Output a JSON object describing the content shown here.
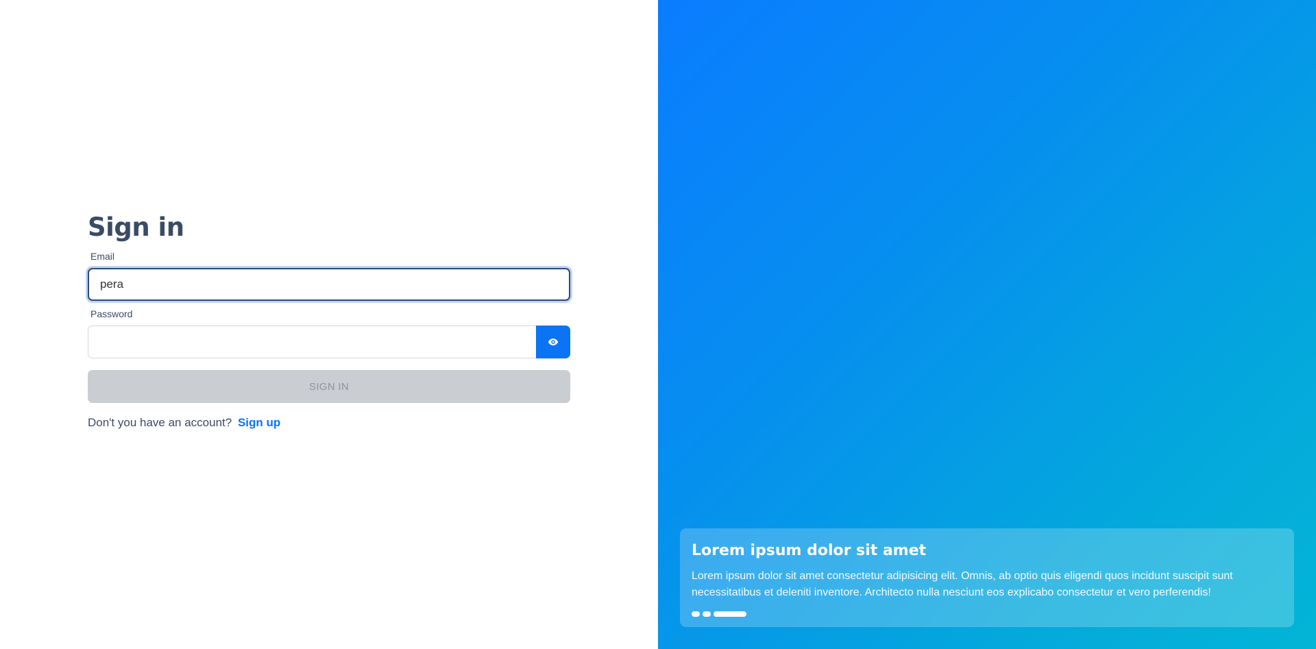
{
  "signin": {
    "title": "Sign in",
    "email_label": "Email",
    "email_value": "pera",
    "password_label": "Password",
    "password_value": "",
    "show_password_icon": "eye-icon",
    "submit_label": "SIGN IN",
    "no_account_text": "Don't you have an account?",
    "signup_link": "Sign up"
  },
  "carousel": {
    "title": "Lorem ipsum dolor sit amet",
    "text": "Lorem ipsum dolor sit amet consectetur adipisicing elit. Omnis, ab optio quis eligendi quos incidunt suscipit sunt necessitatibus et deleniti inventore. Architecto nulla nesciunt eos explicabo consectetur et vero perferendis!",
    "slide_count": 3,
    "active_slide": 3
  },
  "colors": {
    "accent": "#0a74f4",
    "heading": "#3a4b66",
    "disabled_button": "#cacdd1",
    "gradient_start": "#0a7cff",
    "gradient_end": "#03b5d6"
  }
}
